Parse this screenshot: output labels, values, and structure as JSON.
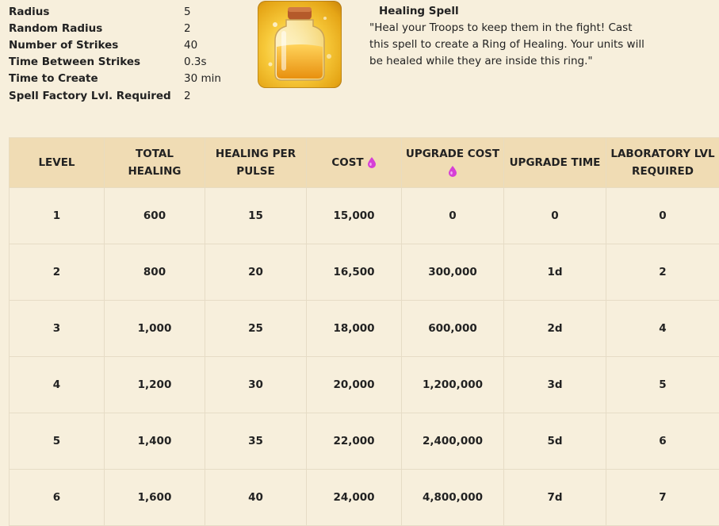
{
  "stats": [
    {
      "label": "Radius",
      "value": "5"
    },
    {
      "label": "Random Radius",
      "value": "2"
    },
    {
      "label": "Number of Strikes",
      "value": "40"
    },
    {
      "label": "Time Between Strikes",
      "value": "0.3s"
    },
    {
      "label": "Time to Create",
      "value": "30 min"
    },
    {
      "label": "Spell Factory Lvl. Required",
      "value": "2"
    }
  ],
  "spell": {
    "title": "Healing Spell",
    "description": "\"Heal your Troops to keep them in the fight! Cast this spell to create a Ring of Healing. Your units will be healed while they are inside this ring.\"",
    "image_icon": "healing-spell-bottle-icon"
  },
  "table": {
    "headers": [
      "LEVEL",
      "TOTAL HEALING",
      "HEALING PER PULSE",
      "COST",
      "UPGRADE COST",
      "UPGRADE TIME",
      "LABORATORY LVL REQUIRED"
    ],
    "currency_icon": "elixir-drop-icon",
    "rows": [
      [
        "1",
        "600",
        "15",
        "15,000",
        "0",
        "0",
        "0"
      ],
      [
        "2",
        "800",
        "20",
        "16,500",
        "300,000",
        "1d",
        "2"
      ],
      [
        "3",
        "1,000",
        "25",
        "18,000",
        "600,000",
        "2d",
        "4"
      ],
      [
        "4",
        "1,200",
        "30",
        "20,000",
        "1,200,000",
        "3d",
        "5"
      ],
      [
        "5",
        "1,400",
        "35",
        "22,000",
        "2,400,000",
        "5d",
        "6"
      ],
      [
        "6",
        "1,600",
        "40",
        "24,000",
        "4,800,000",
        "7d",
        "7"
      ]
    ]
  },
  "colors": {
    "page_background": "#f7efdc",
    "header_background": "#f0dcb4",
    "elixir": "#d63fd6"
  }
}
